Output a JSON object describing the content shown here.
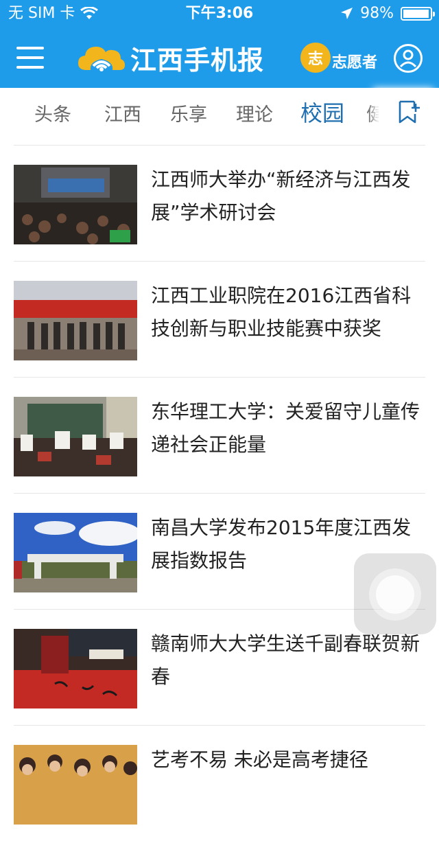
{
  "status_bar": {
    "carrier": "无 SIM 卡",
    "time": "下午3:06",
    "battery": "98%",
    "battery_level": 0.98,
    "wifi_icon": "wifi-icon",
    "location_icon": "location-arrow-icon"
  },
  "app_bar": {
    "logo_text": "江西手机报",
    "volunteer_badge": "志",
    "volunteer_label": "志愿者",
    "colors": {
      "header_bg": "#1f9ce9",
      "accent": "#f3b51c"
    }
  },
  "tabs": {
    "items": [
      "头条",
      "江西",
      "乐享",
      "理论",
      "校园",
      "健"
    ],
    "active": "校园"
  },
  "news": [
    {
      "title": "江西师大举办“新经济与江西发展”学术研讨会"
    },
    {
      "title": "江西工业职院在2016江西省科技创新与职业技能赛中获奖"
    },
    {
      "title": "东华理工大学：关爱留守儿童传递社会正能量"
    },
    {
      "title": "南昌大学发布2015年度江西发展指数报告"
    },
    {
      "title": "赣南师大大学生送千副春联贺新春"
    },
    {
      "title": "艺考不易 未必是高考捷径"
    }
  ]
}
